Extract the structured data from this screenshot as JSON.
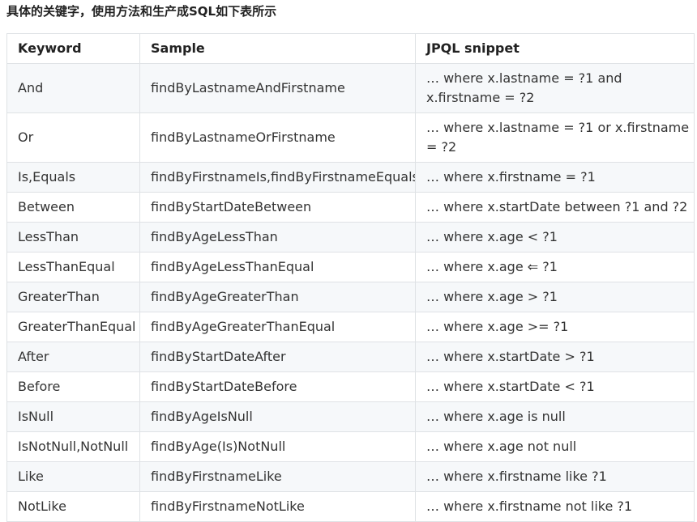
{
  "heading": "具体的关键字，使用方法和生产成SQL如下表所示",
  "columns": [
    "Keyword",
    "Sample",
    "JPQL snippet"
  ],
  "rows": [
    {
      "keyword": "And",
      "sample": "findByLastnameAndFirstname",
      "snippet": "… where x.lastname = ?1 and x.firstname = ?2"
    },
    {
      "keyword": "Or",
      "sample": "findByLastnameOrFirstname",
      "snippet": "… where x.lastname = ?1 or x.firstname = ?2"
    },
    {
      "keyword": "Is,Equals",
      "sample": "findByFirstnameIs,findByFirstnameEquals",
      "snippet": "… where x.firstname = ?1"
    },
    {
      "keyword": "Between",
      "sample": "findByStartDateBetween",
      "snippet": "… where x.startDate between ?1 and ?2"
    },
    {
      "keyword": "LessThan",
      "sample": "findByAgeLessThan",
      "snippet": "… where x.age < ?1"
    },
    {
      "keyword": "LessThanEqual",
      "sample": "findByAgeLessThanEqual",
      "snippet": "… where x.age ⇐ ?1"
    },
    {
      "keyword": "GreaterThan",
      "sample": "findByAgeGreaterThan",
      "snippet": "… where x.age > ?1"
    },
    {
      "keyword": "GreaterThanEqual",
      "sample": "findByAgeGreaterThanEqual",
      "snippet": "… where x.age >= ?1"
    },
    {
      "keyword": "After",
      "sample": "findByStartDateAfter",
      "snippet": "… where x.startDate > ?1"
    },
    {
      "keyword": "Before",
      "sample": "findByStartDateBefore",
      "snippet": "… where x.startDate < ?1"
    },
    {
      "keyword": "IsNull",
      "sample": "findByAgeIsNull",
      "snippet": "… where x.age is null"
    },
    {
      "keyword": "IsNotNull,NotNull",
      "sample": "findByAge(Is)NotNull",
      "snippet": "… where x.age not null"
    },
    {
      "keyword": "Like",
      "sample": "findByFirstnameLike",
      "snippet": "… where x.firstname like ?1"
    },
    {
      "keyword": "NotLike",
      "sample": "findByFirstnameNotLike",
      "snippet": "… where x.firstname not like ?1"
    }
  ]
}
